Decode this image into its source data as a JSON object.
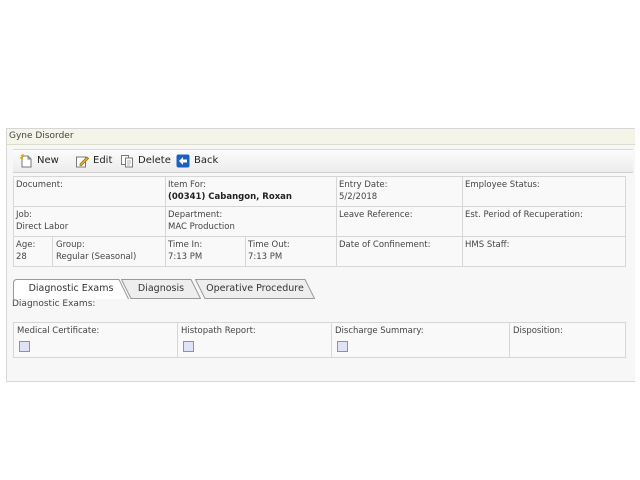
{
  "window": {
    "title": "Gyne Disorder"
  },
  "toolbar": {
    "new": "New",
    "edit": "Edit",
    "delete": "Delete",
    "back": "Back"
  },
  "info": {
    "document_label": "Document:",
    "item_for_label": "Item For:",
    "item_for_value": "(00341) Cabangon, Roxan",
    "entry_date_label": "Entry Date:",
    "entry_date_value": "5/2/2018",
    "employee_status_label": "Employee Status:",
    "job_label": "Job:",
    "job_value": "Direct Labor",
    "department_label": "Department:",
    "department_value": "MAC Production",
    "leave_ref_label": "Leave Reference:",
    "recuperation_label": "Est. Period of Recuperation:",
    "age_label": "Age:",
    "age_value": "28",
    "group_label": "Group:",
    "group_value": "Regular (Seasonal)",
    "time_in_label": "Time In:",
    "time_in_value": "7:13 PM",
    "time_out_label": "Time Out:",
    "time_out_value": "7:13 PM",
    "confinement_label": "Date of Confinement:",
    "hms_staff_label": "HMS Staff:"
  },
  "tabs": [
    {
      "label": "Diagnostic Exams",
      "active": true
    },
    {
      "label": "Diagnosis",
      "active": false
    },
    {
      "label": "Operative Procedure",
      "active": false
    }
  ],
  "section": {
    "heading": "Diagnostic Exams:"
  },
  "exams": {
    "medical_certificate": "Medical Certificate:",
    "histopath_report": "Histopath Report:",
    "discharge_summary": "Discharge Summary:",
    "disposition": "Disposition:"
  },
  "colors": {
    "back_icon": "#1a5fc2",
    "active_tab_bg": "#ffffff",
    "inactive_tab_bg": "#eeeeee"
  }
}
